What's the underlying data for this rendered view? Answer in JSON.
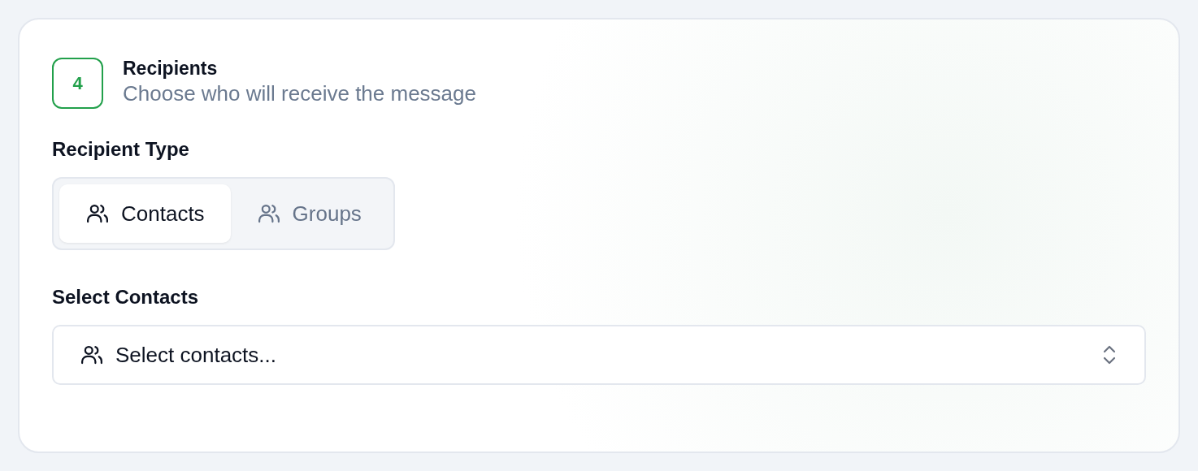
{
  "step": {
    "number": "4",
    "title": "Recipients",
    "subtitle": "Choose who will receive the message"
  },
  "recipient_type": {
    "label": "Recipient Type",
    "options": [
      {
        "label": "Contacts",
        "selected": true
      },
      {
        "label": "Groups",
        "selected": false
      }
    ]
  },
  "select_contacts": {
    "label": "Select Contacts",
    "placeholder": "Select contacts..."
  }
}
